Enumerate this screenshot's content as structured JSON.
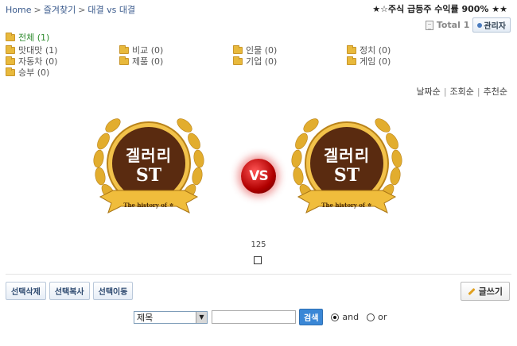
{
  "breadcrumb": {
    "home": "Home",
    "favorites": "즐겨찾기",
    "current": "대결 vs 대결"
  },
  "promo": "★☆주식 급등주 수익률 900% ★★",
  "toolbar": {
    "total_label": "Total",
    "total_count": "1",
    "admin_label": "관리자"
  },
  "categories": [
    {
      "label": "전체 (1)"
    },
    {
      "label": "맛대맛 (1)"
    },
    {
      "label": "비교 (0)"
    },
    {
      "label": "인물 (0)"
    },
    {
      "label": "정치 (0)"
    },
    {
      "label": "자동차 (0)"
    },
    {
      "label": "제품 (0)"
    },
    {
      "label": "기업 (0)"
    },
    {
      "label": "게임 (0)"
    },
    {
      "label": "승부 (0)"
    }
  ],
  "sort": {
    "date": "날짜순",
    "views": "조회순",
    "recommend": "추천순"
  },
  "gallery": {
    "left": {
      "title1": "겔러리",
      "title2": "ST",
      "ribbon": "The history of ㅎ"
    },
    "right": {
      "title1": "겔러리",
      "title2": "ST",
      "ribbon": "The history of ㅎ"
    },
    "vs": "VS",
    "count": "125"
  },
  "actions": {
    "delete": "선택삭제",
    "copy": "선택복사",
    "move": "선택이동",
    "write": "글쓰기"
  },
  "search": {
    "field_value": "제목",
    "input_value": "",
    "button": "검색",
    "and_label": "and",
    "or_label": "or"
  },
  "colors": {
    "gold": "#e8b93c",
    "brown": "#5a2b10",
    "vs_red": "#b10000",
    "search_blue": "#3a87d6"
  }
}
